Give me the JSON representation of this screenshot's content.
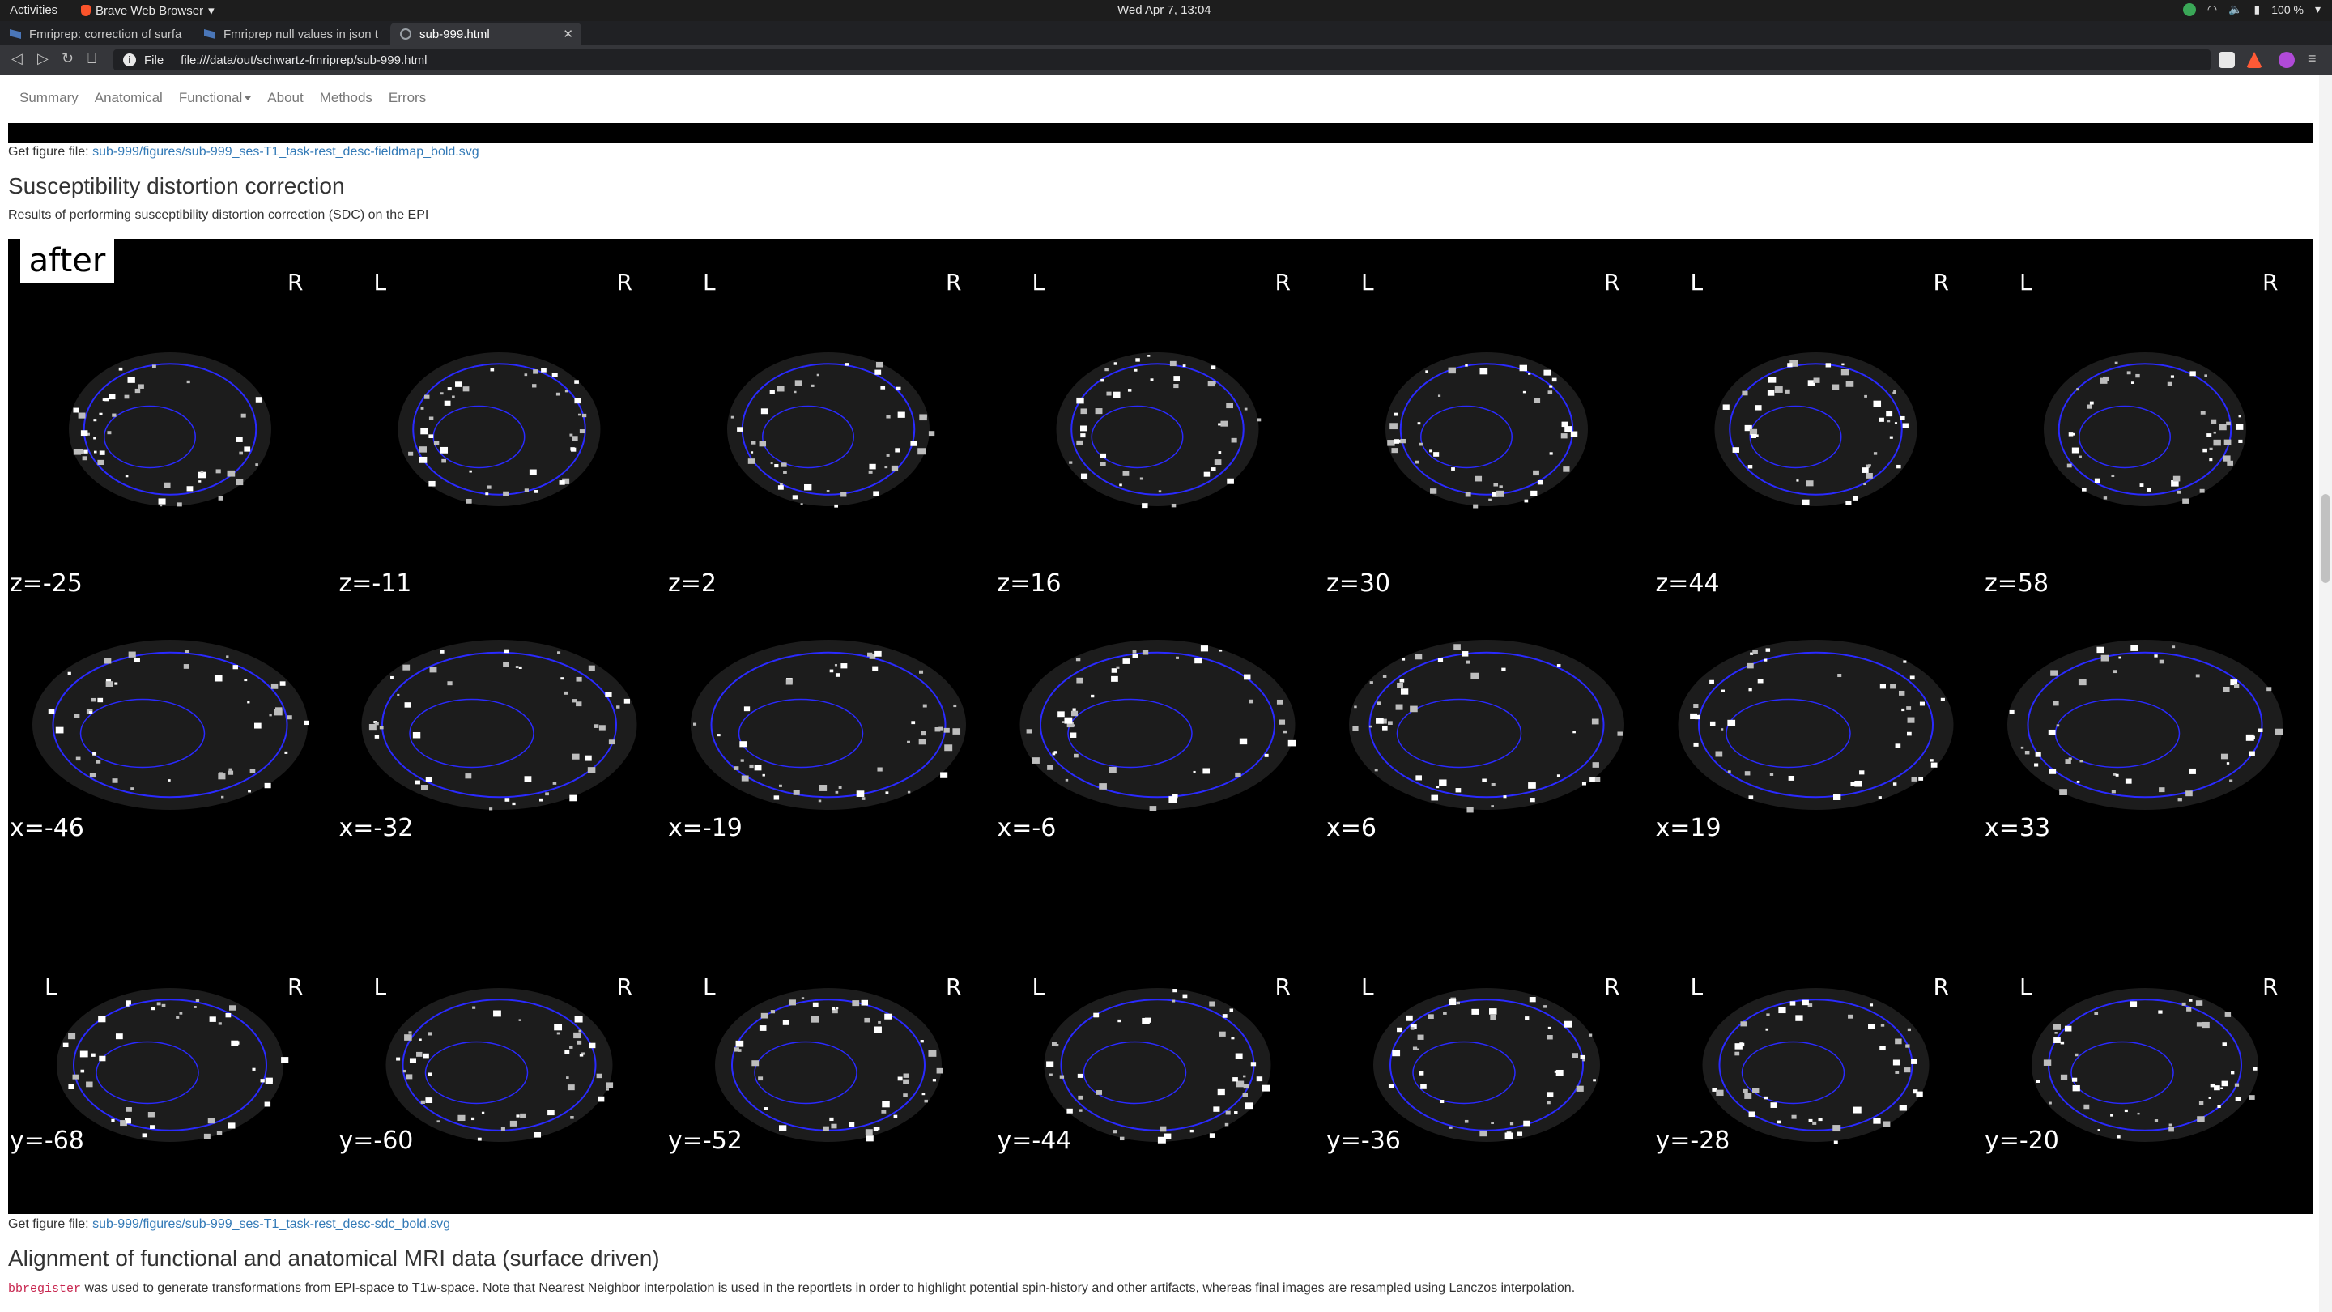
{
  "system": {
    "activities": "Activities",
    "app_name": "Brave Web Browser",
    "clock": "Wed Apr  7, 13:04",
    "battery": "100 %"
  },
  "tabs": [
    {
      "label": "Fmriprep: correction of surfa"
    },
    {
      "label": "Fmriprep null values in json t"
    },
    {
      "label": "sub-999.html",
      "active": true
    }
  ],
  "address": {
    "scheme": "File",
    "url": "file:///data/out/schwartz-fmriprep/sub-999.html"
  },
  "nav": {
    "items": [
      "Summary",
      "Anatomical",
      "Functional",
      "About",
      "Methods",
      "Errors"
    ]
  },
  "fieldmap": {
    "link_prefix": "Get figure file:",
    "link": "sub-999/figures/sub-999_ses-T1_task-rest_desc-fieldmap_bold.svg"
  },
  "sdc": {
    "title": "Susceptibility distortion correction",
    "description": "Results of performing susceptibility distortion correction (SDC) on the EPI",
    "overlay_label": "after",
    "rows": [
      {
        "axis": "z",
        "labels": [
          "z=-25",
          "z=-11",
          "z=2",
          "z=16",
          "z=30",
          "z=44",
          "z=58"
        ]
      },
      {
        "axis": "x",
        "labels": [
          "x=-46",
          "x=-32",
          "x=-19",
          "x=-6",
          "x=6",
          "x=19",
          "x=33"
        ]
      },
      {
        "axis": "y",
        "labels": [
          "y=-68",
          "y=-60",
          "y=-52",
          "y=-44",
          "y=-36",
          "y=-28",
          "y=-20"
        ]
      }
    ],
    "side_left": "L",
    "side_right": "R",
    "link_prefix": "Get figure file:",
    "link": "sub-999/figures/sub-999_ses-T1_task-rest_desc-sdc_bold.svg",
    "contour_color": "#2a2aff"
  },
  "bbr": {
    "title": "Alignment of functional and anatomical MRI data (surface driven)",
    "tool": "bbregister",
    "description": " was used to generate transformations from EPI-space to T1w-space. Note that Nearest Neighbor interpolation is used in the reportlets in order to highlight potential spin-history and other artifacts, whereas final images are resampled using Lanczos interpolation."
  }
}
